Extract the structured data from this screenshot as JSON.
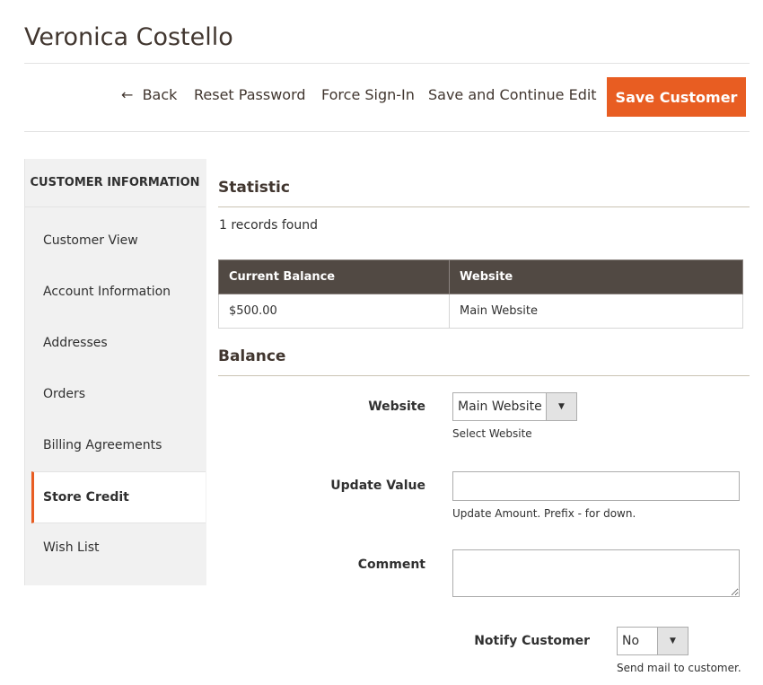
{
  "page": {
    "title": "Veronica Costello"
  },
  "toolbar": {
    "back": "Back",
    "reset_password": "Reset Password",
    "force_signin": "Force Sign-In",
    "save_continue": "Save and Continue Edit",
    "save_customer": "Save Customer"
  },
  "sidebar": {
    "heading": "CUSTOMER INFORMATION",
    "items": [
      {
        "label": "Customer View"
      },
      {
        "label": "Account Information"
      },
      {
        "label": "Addresses"
      },
      {
        "label": "Orders"
      },
      {
        "label": "Billing Agreements"
      },
      {
        "label": "Store Credit",
        "active": true
      },
      {
        "label": "Wish List"
      }
    ]
  },
  "statistic": {
    "heading": "Statistic",
    "records": "1 records found",
    "columns": [
      "Current Balance",
      "Website"
    ],
    "rows": [
      [
        "$500.00",
        "Main Website"
      ]
    ]
  },
  "balance": {
    "heading": "Balance",
    "website": {
      "label": "Website",
      "value": "Main Website",
      "help": "Select Website"
    },
    "update_value": {
      "label": "Update Value",
      "value": "",
      "help": "Update Amount. Prefix - for down."
    },
    "comment": {
      "label": "Comment",
      "value": ""
    },
    "notify": {
      "label": "Notify Customer",
      "value": "No",
      "help": "Send mail to customer."
    }
  },
  "colors": {
    "accent": "#e85d22",
    "table_header": "#514943"
  }
}
